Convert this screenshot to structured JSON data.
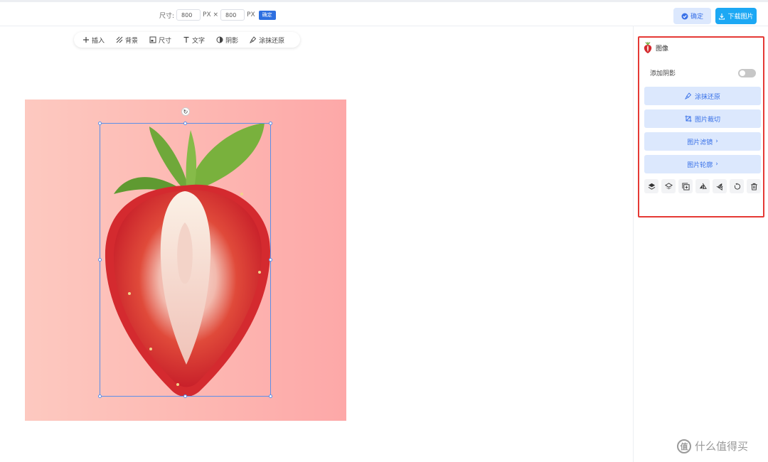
{
  "topbar": {
    "size_label": "尺寸:",
    "width_value": "800",
    "px_x": "PX ×",
    "height_value": "800",
    "px_unit": "PX",
    "size_confirm": "确定",
    "confirm_button": "确定",
    "download_button": "下载图片",
    "colors": {
      "confirm_bg": "#dce8fd",
      "download_bg": "#1ca8f4"
    }
  },
  "toolbar": {
    "items": [
      {
        "label": "插入",
        "icon": "plus-icon"
      },
      {
        "label": "背景",
        "icon": "background-icon"
      },
      {
        "label": "尺寸",
        "icon": "resize-icon"
      },
      {
        "label": "文字",
        "icon": "text-icon"
      },
      {
        "label": "阴影",
        "icon": "shadow-icon"
      },
      {
        "label": "涂抹还原",
        "icon": "brush-icon"
      }
    ]
  },
  "canvas": {
    "background_gradient": [
      "#fdc9c0",
      "#fda8a8"
    ],
    "image": "strawberry-half"
  },
  "panel": {
    "title": "图像",
    "shadow_label": "添加阴影",
    "shadow_enabled": false,
    "actions": [
      "涂抹还原",
      "图片裁切",
      "图片滤镜",
      "图片轮廓"
    ],
    "icons": [
      "layer-up-icon",
      "layer-down-icon",
      "duplicate-icon",
      "flip-horizontal-icon",
      "flip-vertical-icon",
      "reset-icon",
      "delete-icon"
    ],
    "highlight_color": "#e53935"
  },
  "watermark": {
    "text": "什么值得买",
    "badge": "值"
  }
}
